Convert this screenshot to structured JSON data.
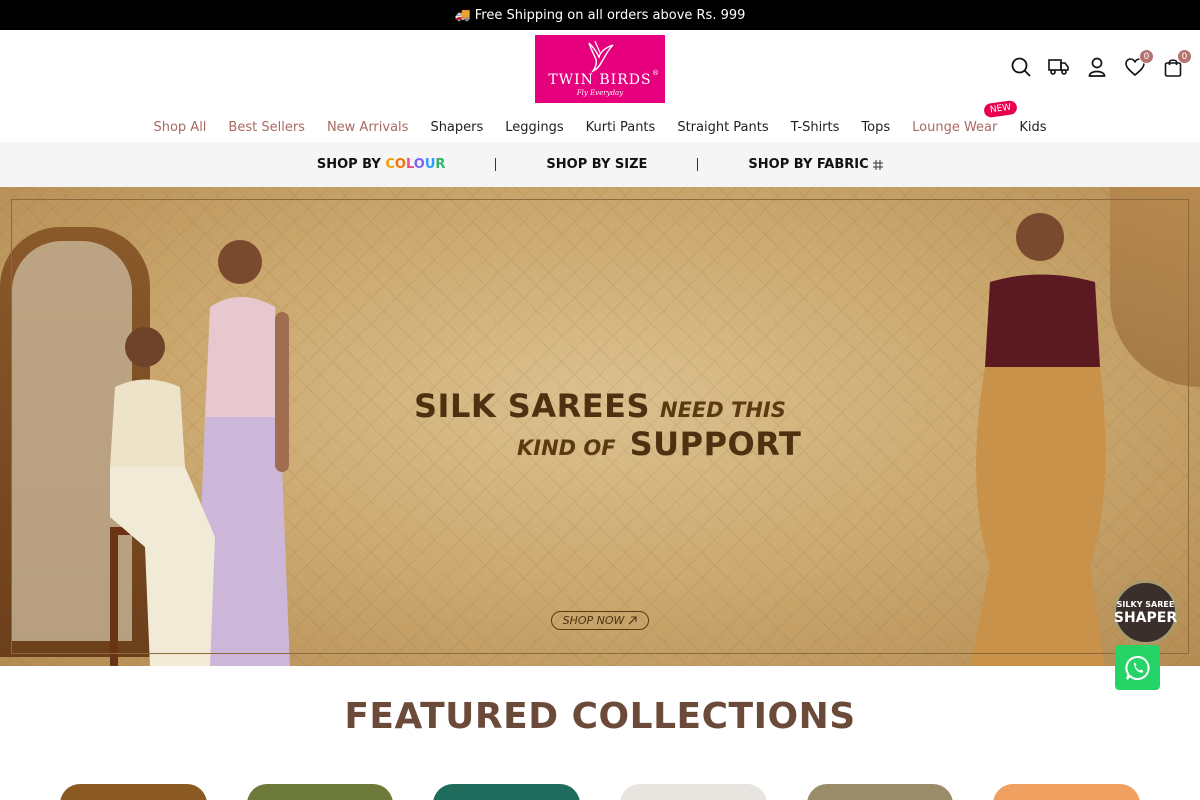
{
  "announcement": {
    "text": "Free Shipping on all orders above Rs. 999"
  },
  "logo": {
    "brand": "TWIN BIRDS",
    "registered": "®",
    "tagline": "Fly Everyday"
  },
  "header": {
    "wishlist_count": "0",
    "cart_count": "0"
  },
  "nav": [
    {
      "label": "Shop All"
    },
    {
      "label": "Best Sellers"
    },
    {
      "label": "New Arrivals"
    },
    {
      "label": "Shapers"
    },
    {
      "label": "Leggings"
    },
    {
      "label": "Kurti Pants"
    },
    {
      "label": "Straight Pants"
    },
    {
      "label": "T-Shirts"
    },
    {
      "label": "Tops"
    },
    {
      "label": "Lounge Wear",
      "tag": "NEW"
    },
    {
      "label": "Kids"
    }
  ],
  "shopby": {
    "colour_prefix": "SHOP BY",
    "colour_word": [
      "C",
      "O",
      "L",
      "O",
      "U",
      "R"
    ],
    "size": "SHOP BY SIZE",
    "fabric": "SHOP BY FABRIC"
  },
  "hero": {
    "line1_big": "SILK SAREES",
    "line1_small": "NEED THIS",
    "line2_small": "KIND OF",
    "line2_big": "SUPPORT",
    "cta": "SHOP NOW",
    "badge_top": "SILKY SAREE",
    "badge_bottom": "SHAPER"
  },
  "featured": {
    "title": "FEATURED COLLECTIONS"
  },
  "colors": {
    "brand_pink": "#e6007e",
    "nav_rose": "#a86a64",
    "featured_title": "#6b4a3a",
    "whatsapp": "#25d366"
  },
  "icons": [
    "truck-icon",
    "search-icon",
    "delivery-icon",
    "user-icon",
    "heart-icon",
    "bag-icon",
    "whatsapp-icon",
    "arrow-up-right-icon",
    "fabric-grid-icon"
  ]
}
